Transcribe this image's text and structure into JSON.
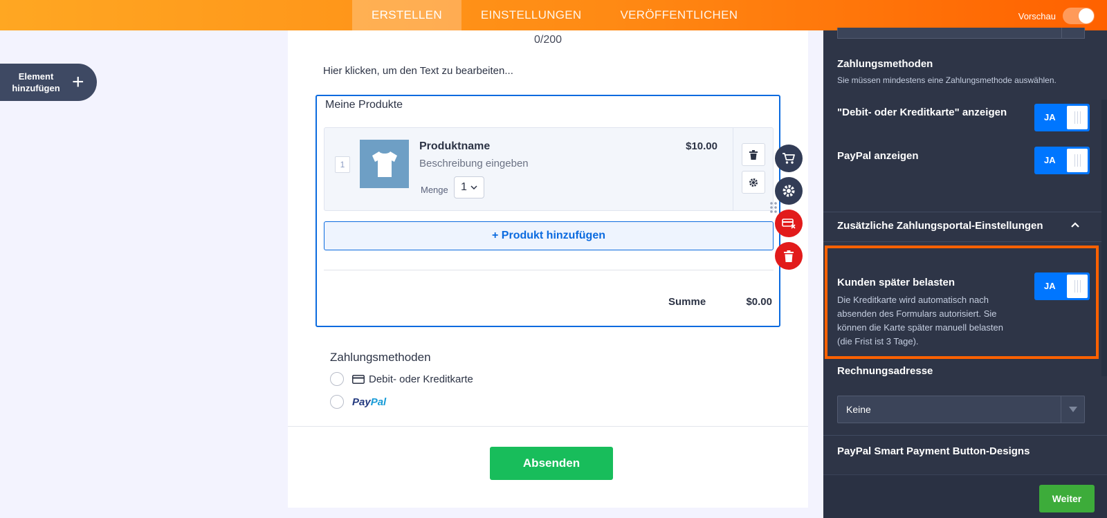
{
  "topbar": {
    "tabs": [
      {
        "label": "ERSTELLEN",
        "active": true
      },
      {
        "label": "EINSTELLUNGEN",
        "active": false
      },
      {
        "label": "VERÖFFENTLICHEN",
        "active": false
      }
    ],
    "preview_label": "Vorschau"
  },
  "sidebar": {
    "add_element_line1": "Element",
    "add_element_line2": "hinzufügen",
    "plus_symbol": "+"
  },
  "form": {
    "counter": "0/200",
    "click_text": "Hier klicken, um den Text zu bearbeiten...",
    "products_title": "Meine Produkte",
    "product": {
      "number": "1",
      "name": "Produktname",
      "description": "Beschreibung eingeben",
      "price": "$10.00",
      "quantity_label": "Menge",
      "quantity_value": "1"
    },
    "add_product_label": "+ Produkt hinzufügen",
    "sum_label": "Summe",
    "sum_value": "$0.00",
    "payment_title": "Zahlungsmethoden",
    "payment_options": [
      {
        "label": "Debit- oder Kreditkarte",
        "icon": "credit-card-icon"
      },
      {
        "label": "PayPal",
        "icon": "paypal-logo"
      }
    ],
    "submit_label": "Absenden"
  },
  "panel": {
    "payment_methods_heading": "Zahlungsmethoden",
    "payment_methods_sub": "Sie müssen mindestens eine Zahlungsmethode auswählen.",
    "show_card_label": "\"Debit- oder Kreditkarte\" anzeigen",
    "show_paypal_label": "PayPal anzeigen",
    "toggle_yes": "JA",
    "extra_settings_heading": "Zusätzliche Zahlungsportal-Einstellungen",
    "charge_later_label": "Kunden später belasten",
    "charge_later_desc": "Die Kreditkarte wird automatisch nach absenden des Formulars autorisiert. Sie können die Karte später manuell belasten (die Frist ist 3 Tage).",
    "billing_label": "Rechnungsadresse",
    "billing_value": "Keine",
    "button_designs_heading": "PayPal Smart Payment Button-Designs",
    "next_label": "Weiter"
  },
  "colors": {
    "accent_orange": "#ff6100",
    "toggle_blue": "#0076ff",
    "submit_green": "#18bd5b",
    "panel_bg": "#2e3547",
    "delete_red": "#e21b1b"
  }
}
